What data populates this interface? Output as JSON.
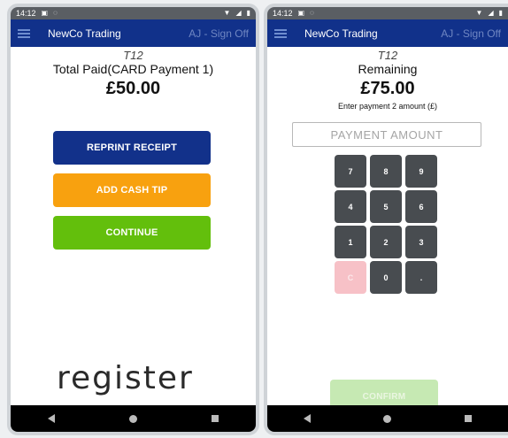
{
  "status": {
    "time": "14:12",
    "left_icons": [
      "notification-icon",
      "sim-icon"
    ],
    "right_icons": [
      "wifi-icon",
      "signal-icon",
      "battery-icon"
    ]
  },
  "appbar": {
    "title": "NewCo Trading",
    "sign_off": "AJ - Sign Off"
  },
  "left_screen": {
    "table": "T12",
    "heading": "Total Paid(CARD Payment 1)",
    "amount": "£50.00",
    "buttons": {
      "reprint": "REPRINT RECEIPT",
      "tip": "ADD CASH TIP",
      "continue": "CONTINUE"
    },
    "logo": "register",
    "colors": {
      "reprint": "#12318a",
      "tip": "#f8a10f",
      "continue": "#63bf0c"
    }
  },
  "right_screen": {
    "table": "T12",
    "heading": "Remaining",
    "amount": "£75.00",
    "enter_label": "Enter payment 2 amount (£)",
    "input_placeholder": "PAYMENT AMOUNT",
    "input_value": "",
    "keypad": {
      "k7": "7",
      "k8": "8",
      "k9": "9",
      "k4": "4",
      "k5": "5",
      "k6": "6",
      "k1": "1",
      "k2": "2",
      "k3": "3",
      "kc": "C",
      "k0": "0",
      "kdot": "."
    },
    "confirm": "CONFIRM"
  }
}
